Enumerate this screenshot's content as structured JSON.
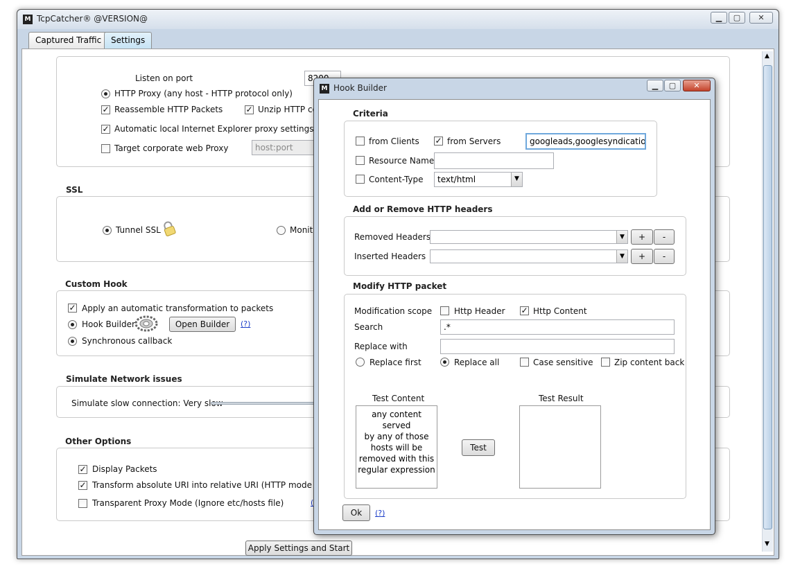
{
  "window": {
    "title": "TcpCatcher®  @VERSION@",
    "tabs": [
      "Captured Traffic",
      "Settings"
    ]
  },
  "settings": {
    "proxy": {
      "listen_port_label": "Listen on port",
      "listen_port_value": "8200",
      "http_proxy": "HTTP Proxy (any host - HTTP protocol only)",
      "reassemble": "Reassemble HTTP Packets",
      "unzip": "Unzip HTTP co",
      "ie_proxy": "Automatic local Internet Explorer proxy settings",
      "corporate_proxy": "Target corporate web Proxy",
      "corporate_placeholder": "host:port"
    },
    "ssl": {
      "title": "SSL",
      "tunnel": "Tunnel SSL",
      "monitor": "Monito"
    },
    "custom_hook": {
      "title": "Custom Hook",
      "apply": "Apply an automatic transformation to packets",
      "hook_builder": "Hook Builder",
      "open_builder": "Open Builder",
      "help": "(?)",
      "sync_callback": "Synchronous callback"
    },
    "network": {
      "title": "Simulate Network issues",
      "slow": "Simulate slow connection: Very slow"
    },
    "other": {
      "title": "Other Options",
      "display_packets": "Display Packets",
      "transform_uri": "Transform absolute URI into relative URI (HTTP mode only",
      "transparent": "Transparent Proxy Mode (Ignore etc/hosts file)",
      "help_fragment": "("
    },
    "apply_button": "Apply Settings and Start"
  },
  "dialog": {
    "title": "Hook Builder",
    "criteria": {
      "title": "Criteria",
      "from_clients": "from Clients",
      "from_servers": "from Servers",
      "servers_value": "googleads,googlesyndication",
      "resource_name": "Resource Name",
      "content_type": "Content-Type",
      "content_type_value": "text/html"
    },
    "headers": {
      "title": "Add or Remove HTTP headers",
      "removed": "Removed Headers",
      "inserted": "Inserted Headers",
      "plus": "+",
      "minus": "-"
    },
    "modify": {
      "title": "Modify HTTP packet",
      "scope": "Modification scope",
      "http_header": "Http Header",
      "http_content": "Http Content",
      "search": "Search",
      "search_value": ".*",
      "replace_with": "Replace with",
      "replace_first": "Replace first",
      "replace_all": "Replace all",
      "case_sensitive": "Case sensitive",
      "zip_back": "Zip content back",
      "test_content_label": "Test Content",
      "test_content": [
        "any content served",
        "by any of those",
        "hosts will be",
        "removed with this",
        "regular expression"
      ],
      "test_result_label": "Test Result",
      "test_button": "Test"
    },
    "ok": "Ok",
    "help": "(?)"
  }
}
